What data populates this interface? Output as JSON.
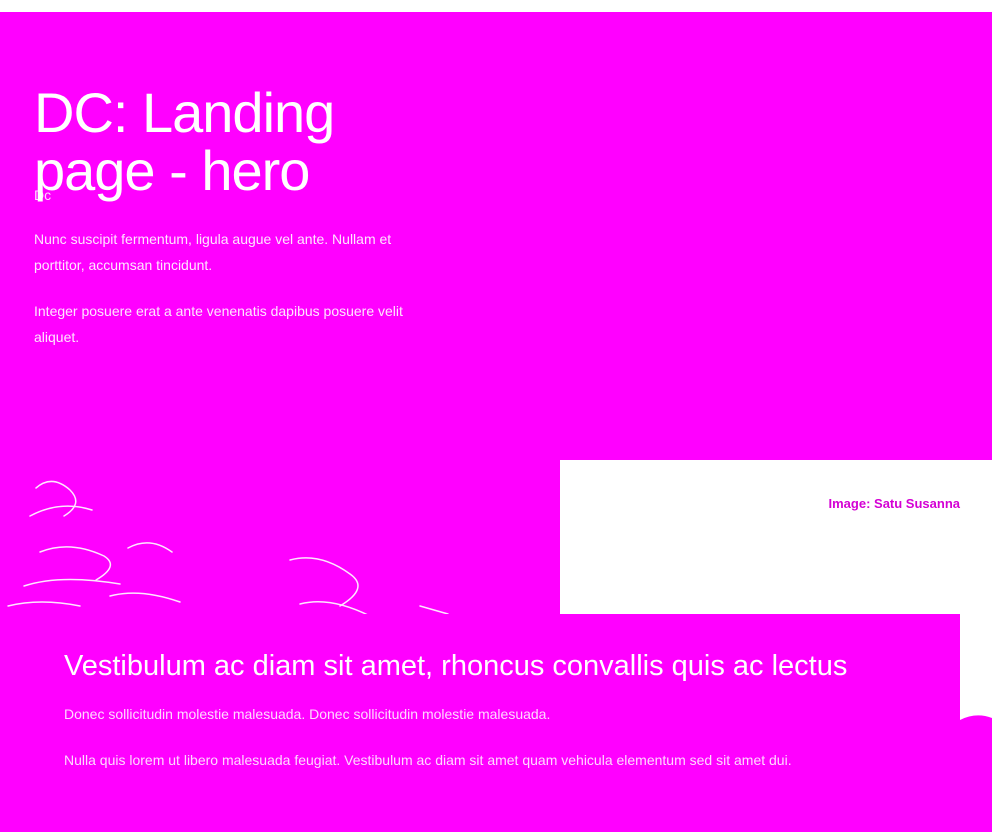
{
  "hero": {
    "title": "DC: Landing page - hero",
    "subtitle": "Dc",
    "paragraph_1": "Nunc suscipit fermentum, ligula augue vel ante. Nullam et porttitor, accumsan tincidunt.",
    "paragraph_2": "Integer posuere erat a ante venenatis dapibus posuere velit aliquet.",
    "right_text": ""
  },
  "image": {
    "caption": "Image: Satu Susanna",
    "alt_icon": "sketch-illustration-icon"
  },
  "card": {
    "heading": "Vestibulum ac diam sit amet, rhoncus convallis quis ac lectus",
    "paragraph_1": "Donec sollicitudin molestie malesuada. Donec sollicitudin molestie malesuada.",
    "paragraph_2": "Nulla quis lorem ut libero malesuada feugiat. Vestibulum ac diam sit amet quam vehicula elementum sed sit amet dui."
  },
  "colors": {
    "brand": "#ff00ff",
    "caption": "#d400d4",
    "text_on_brand": "#ffffff"
  }
}
